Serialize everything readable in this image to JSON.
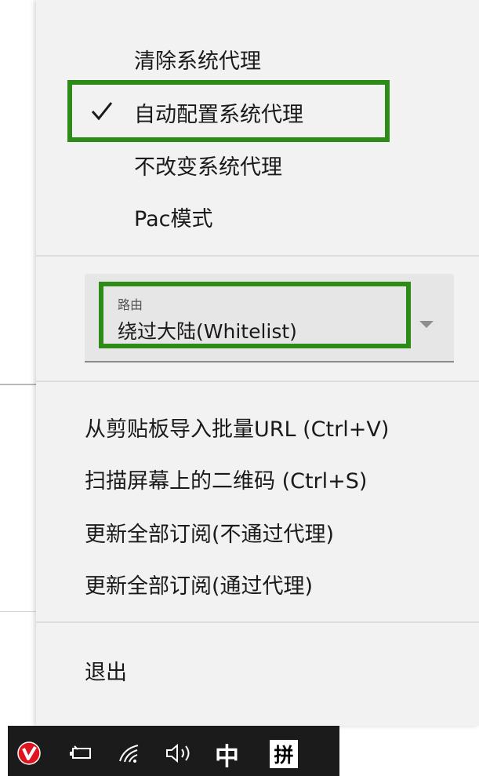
{
  "menu": {
    "proxy_modes": [
      {
        "label": "清除系统代理",
        "checked": false
      },
      {
        "label": "自动配置系统代理",
        "checked": true
      },
      {
        "label": "不改变系统代理",
        "checked": false
      },
      {
        "label": "Pac模式",
        "checked": false
      }
    ],
    "routing": {
      "header": "路由",
      "value": "绕过大陆(Whitelist)"
    },
    "actions": [
      {
        "label": "从剪贴板导入批量URL (Ctrl+V)"
      },
      {
        "label": "扫描屏幕上的二维码 (Ctrl+S)"
      },
      {
        "label": "更新全部订阅(不通过代理)"
      },
      {
        "label": "更新全部订阅(通过代理)"
      }
    ],
    "exit_label": "退出"
  },
  "taskbar": {
    "ime_language": "中",
    "ime_mode": "拼"
  },
  "colors": {
    "highlight": "#2e8b17",
    "menu_background": "#f2f2f2",
    "taskbar_background": "#1b1b1b",
    "v2ray_icon": "#e0141e"
  },
  "icons": [
    "check-icon",
    "dropdown-arrow-icon",
    "v2ray-tray-icon",
    "battery-icon",
    "wifi-icon",
    "speaker-icon"
  ]
}
